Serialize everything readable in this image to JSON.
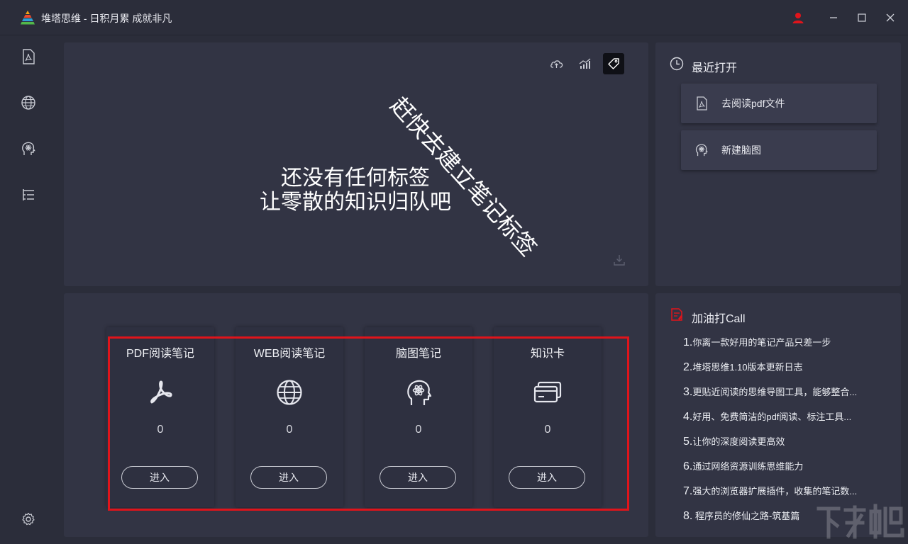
{
  "app": {
    "title": "堆塔思维 - 日积月累 成就非凡"
  },
  "colors": {
    "accent_red": "#e0141b",
    "user_icon": "#e0141b",
    "background": "#2b2d3a",
    "panel": "#323444"
  },
  "sidebar": {
    "items": [
      {
        "icon": "pdf-icon"
      },
      {
        "icon": "globe-icon"
      },
      {
        "icon": "brain-icon"
      },
      {
        "icon": "list-icon"
      }
    ],
    "settings_icon": "gear-icon"
  },
  "toolbar": {
    "icons": [
      "cloud-upload-icon",
      "chart-icon",
      "tag-icon"
    ],
    "active": "tag-icon"
  },
  "tag_area": {
    "empty_line1": "还没有任何标签",
    "empty_line2": "让零散的知识归队吧",
    "diagonal_hint": "赶快去建立笔记标签"
  },
  "recent": {
    "title": "最近打开",
    "items": [
      {
        "label": "去阅读pdf文件",
        "icon": "pdf-icon"
      },
      {
        "label": "新建脑图",
        "icon": "brain-icon"
      }
    ]
  },
  "cards": [
    {
      "title": "PDF阅读笔记",
      "icon": "acrobat-icon",
      "count": "0",
      "button": "进入"
    },
    {
      "title": "WEB阅读笔记",
      "icon": "globe-icon",
      "count": "0",
      "button": "进入"
    },
    {
      "title": "脑图笔记",
      "icon": "brain-icon",
      "count": "0",
      "button": "进入"
    },
    {
      "title": "知识卡",
      "icon": "card-icon",
      "count": "0",
      "button": "进入"
    }
  ],
  "news": {
    "title": "加油打Call",
    "items": [
      {
        "num": "1.",
        "text": "你离一款好用的笔记产品只差一步"
      },
      {
        "num": "2.",
        "text": "堆塔思维1.10版本更新日志"
      },
      {
        "num": "3.",
        "text": "更贴近阅读的思维导图工具，能够整合..."
      },
      {
        "num": "4.",
        "text": "好用、免费简洁的pdf阅读、标注工具..."
      },
      {
        "num": "5.",
        "text": "让你的深度阅读更高效"
      },
      {
        "num": "6.",
        "text": "通过网络资源训练思维能力"
      },
      {
        "num": "7.",
        "text": "强大的浏览器扩展插件，收集的笔记数..."
      },
      {
        "num": "8.",
        "text": " 程序员的修仙之路-筑基篇"
      }
    ]
  }
}
